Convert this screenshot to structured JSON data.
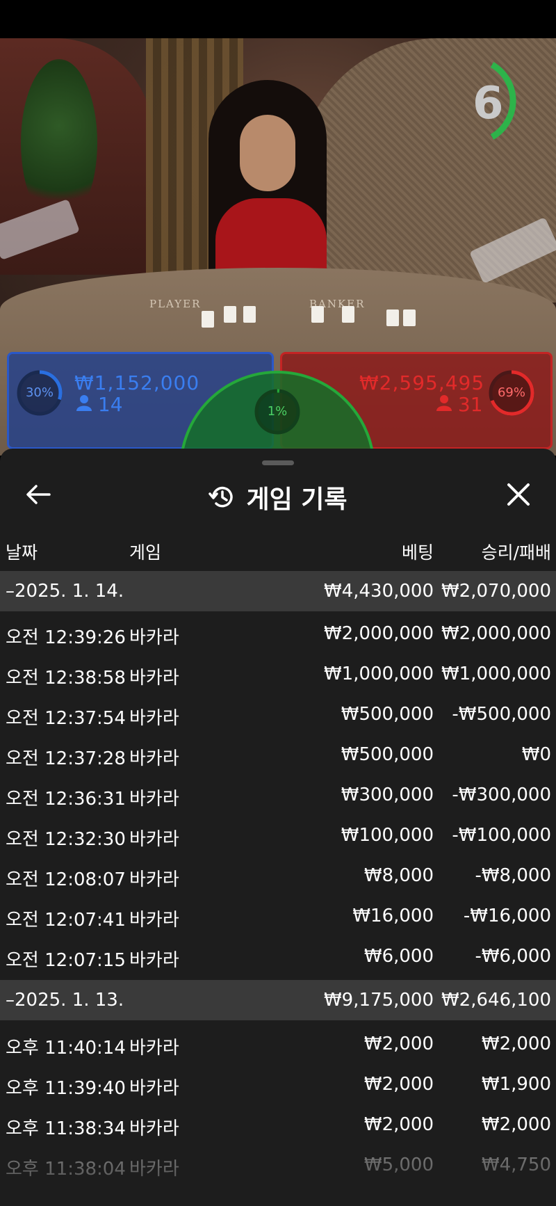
{
  "overlay": {
    "countdown": "6",
    "table_labels": {
      "player": "PLAYER",
      "banker": "BANKER"
    },
    "player": {
      "percent": "30%",
      "amount": "₩1,152,000",
      "count": "14",
      "color": "#2a6fe0"
    },
    "banker": {
      "percent": "69%",
      "amount": "₩2,595,495",
      "count": "31",
      "color": "#e22a2a"
    },
    "tie": {
      "percent": "1%",
      "color": "#25a83a"
    }
  },
  "sheet": {
    "title": "게임 기록",
    "icons": {
      "back": "arrow-left-icon",
      "history": "history-icon",
      "close": "close-icon"
    },
    "columns": {
      "date": "날짜",
      "game": "게임",
      "bet": "베팅",
      "result": "승리/패배"
    },
    "groups": [
      {
        "date": "–2025. 1. 14.",
        "bet_total": "₩4,430,000",
        "result_total": "₩2,070,000",
        "rows": [
          {
            "time": "오전 12:39:26",
            "game": "바카라",
            "bet": "₩2,000,000",
            "result": "₩2,000,000"
          },
          {
            "time": "오전 12:38:58",
            "game": "바카라",
            "bet": "₩1,000,000",
            "result": "₩1,000,000"
          },
          {
            "time": "오전 12:37:54",
            "game": "바카라",
            "bet": "₩500,000",
            "result": "-₩500,000"
          },
          {
            "time": "오전 12:37:28",
            "game": "바카라",
            "bet": "₩500,000",
            "result": "₩0"
          },
          {
            "time": "오전 12:36:31",
            "game": "바카라",
            "bet": "₩300,000",
            "result": "-₩300,000"
          },
          {
            "time": "오전 12:32:30",
            "game": "바카라",
            "bet": "₩100,000",
            "result": "-₩100,000"
          },
          {
            "time": "오전 12:08:07",
            "game": "바카라",
            "bet": "₩8,000",
            "result": "-₩8,000"
          },
          {
            "time": "오전 12:07:41",
            "game": "바카라",
            "bet": "₩16,000",
            "result": "-₩16,000"
          },
          {
            "time": "오전 12:07:15",
            "game": "바카라",
            "bet": "₩6,000",
            "result": "-₩6,000"
          }
        ]
      },
      {
        "date": "–2025. 1. 13.",
        "bet_total": "₩9,175,000",
        "result_total": "₩2,646,100",
        "rows": [
          {
            "time": "오후 11:40:14",
            "game": "바카라",
            "bet": "₩2,000",
            "result": "₩2,000"
          },
          {
            "time": "오후 11:39:40",
            "game": "바카라",
            "bet": "₩2,000",
            "result": "₩1,900"
          },
          {
            "time": "오후 11:38:34",
            "game": "바카라",
            "bet": "₩2,000",
            "result": "₩2,000"
          },
          {
            "time": "오후 11:38:04",
            "game": "바카라",
            "bet": "₩5,000",
            "result": "₩4,750"
          }
        ]
      }
    ]
  }
}
